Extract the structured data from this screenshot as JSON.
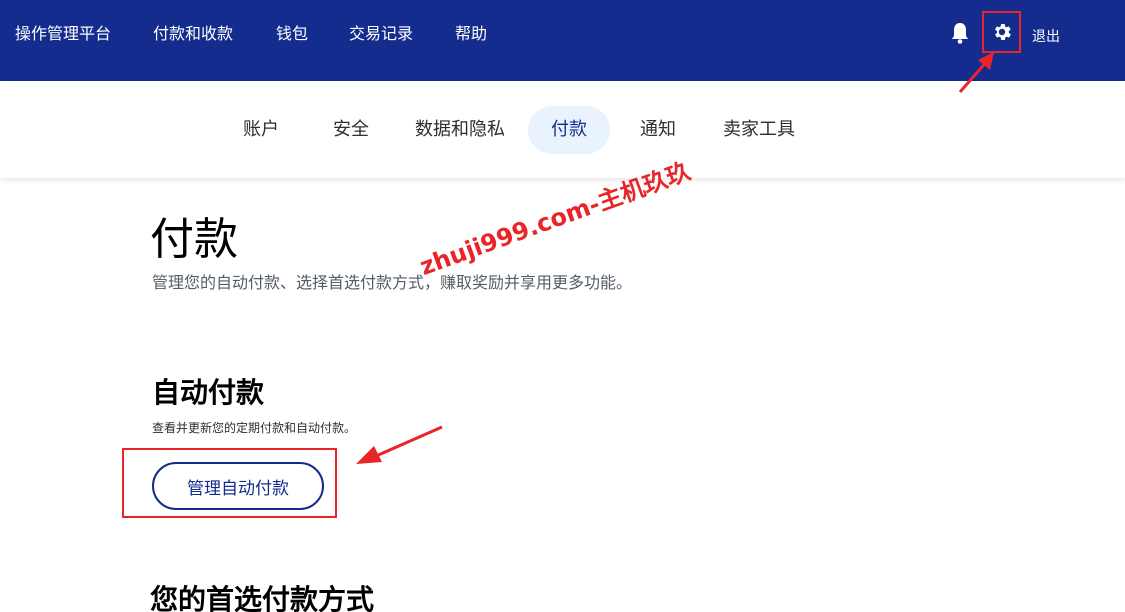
{
  "topnav": {
    "items": [
      {
        "label": "操作管理平台"
      },
      {
        "label": "付款和收款"
      },
      {
        "label": "钱包"
      },
      {
        "label": "交易记录"
      },
      {
        "label": "帮助"
      }
    ],
    "bell_icon": "bell-icon",
    "settings_icon": "gear-icon",
    "logout_label": "退出"
  },
  "tabs": [
    {
      "label": "账户"
    },
    {
      "label": "安全"
    },
    {
      "label": "数据和隐私"
    },
    {
      "label": "付款",
      "active": true
    },
    {
      "label": "通知"
    },
    {
      "label": "卖家工具"
    }
  ],
  "main": {
    "title": "付款",
    "description": "管理您的自动付款、选择首选付款方式，赚取奖励并享用更多功能。",
    "auto_payments": {
      "title": "自动付款",
      "description": "查看并更新您的定期付款和自动付款。",
      "button_label": "管理自动付款"
    },
    "preferred_payment_title": "您的首选付款方式"
  },
  "watermark": "zhuji999.com-主机玖玖",
  "colors": {
    "brand_navy": "#142c8e",
    "active_tab_bg": "#e9f3fd",
    "annotation_red": "#e8262a"
  }
}
